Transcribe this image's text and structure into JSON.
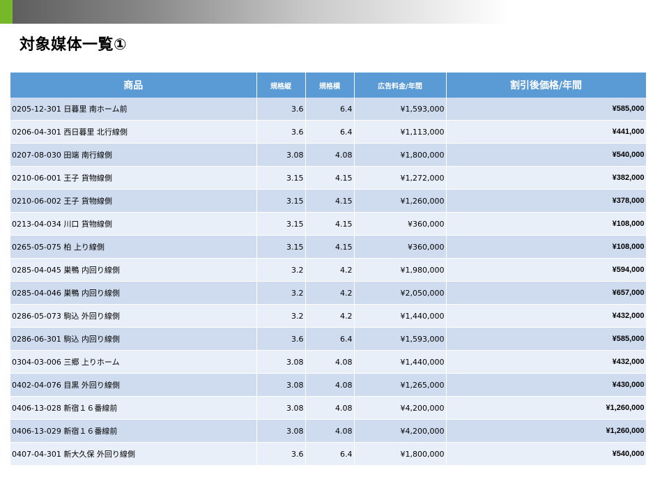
{
  "page": {
    "title": "対象媒体一覧①"
  },
  "table": {
    "headers": {
      "product": "商品",
      "height": "規格縦",
      "width": "規格横",
      "ad_fee": "広告料金/年間",
      "discount": "割引後価格/年間"
    },
    "rows": [
      {
        "name": "0205-12-301 日暮里 南ホーム前",
        "h": "3.6",
        "w": "6.4",
        "fee": "¥1,593,000",
        "discount": "¥585,000"
      },
      {
        "name": "0206-04-301 西日暮里 北行線側",
        "h": "3.6",
        "w": "6.4",
        "fee": "¥1,113,000",
        "discount": "¥441,000"
      },
      {
        "name": "0207-08-030 田端 南行線側",
        "h": "3.08",
        "w": "4.08",
        "fee": "¥1,800,000",
        "discount": "¥540,000"
      },
      {
        "name": "0210-06-001 王子 貨物線側",
        "h": "3.15",
        "w": "4.15",
        "fee": "¥1,272,000",
        "discount": "¥382,000"
      },
      {
        "name": "0210-06-002 王子 貨物線側",
        "h": "3.15",
        "w": "4.15",
        "fee": "¥1,260,000",
        "discount": "¥378,000"
      },
      {
        "name": "0213-04-034 川口 貨物線側",
        "h": "3.15",
        "w": "4.15",
        "fee": "¥360,000",
        "discount": "¥108,000"
      },
      {
        "name": "0265-05-075 柏 上り線側",
        "h": "3.15",
        "w": "4.15",
        "fee": "¥360,000",
        "discount": "¥108,000"
      },
      {
        "name": "0285-04-045 巣鴨 内回り線側",
        "h": "3.2",
        "w": "4.2",
        "fee": "¥1,980,000",
        "discount": "¥594,000"
      },
      {
        "name": "0285-04-046 巣鴨 内回り線側",
        "h": "3.2",
        "w": "4.2",
        "fee": "¥2,050,000",
        "discount": "¥657,000"
      },
      {
        "name": "0286-05-073 駒込 外回り線側",
        "h": "3.2",
        "w": "4.2",
        "fee": "¥1,440,000",
        "discount": "¥432,000"
      },
      {
        "name": "0286-06-301 駒込 内回り線側",
        "h": "3.6",
        "w": "6.4",
        "fee": "¥1,593,000",
        "discount": "¥585,000"
      },
      {
        "name": "0304-03-006 三郷 上りホーム",
        "h": "3.08",
        "w": "4.08",
        "fee": "¥1,440,000",
        "discount": "¥432,000"
      },
      {
        "name": "0402-04-076 目黒 外回り線側",
        "h": "3.08",
        "w": "4.08",
        "fee": "¥1,265,000",
        "discount": "¥430,000"
      },
      {
        "name": "0406-13-028 新宿１６番線前",
        "h": "3.08",
        "w": "4.08",
        "fee": "¥4,200,000",
        "discount": "¥1,260,000"
      },
      {
        "name": "0406-13-029 新宿１６番線前",
        "h": "3.08",
        "w": "4.08",
        "fee": "¥4,200,000",
        "discount": "¥1,260,000"
      },
      {
        "name": "0407-04-301 新大久保 外回り線側",
        "h": "3.6",
        "w": "6.4",
        "fee": "¥1,800,000",
        "discount": "¥540,000"
      }
    ]
  },
  "colors": {
    "header_bg": "#5b9bd5",
    "row_odd": "#cfdcef",
    "row_even": "#e9eff8",
    "discount_text": "#e02020",
    "accent_green": "#76b82a"
  }
}
